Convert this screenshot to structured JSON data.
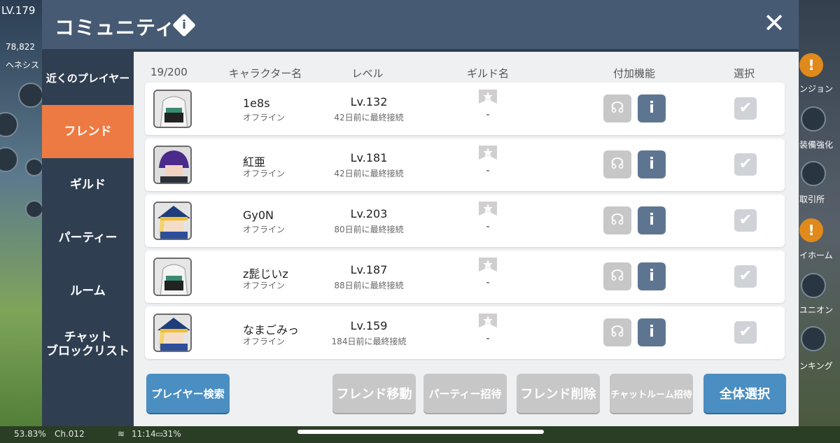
{
  "hud": {
    "level": "LV.179",
    "meso": "78,822",
    "map": "ヘネシス",
    "right_labels": [
      "ンジョン",
      "装備強化",
      "取引所",
      "イホーム",
      "ユニオン",
      "ンキング"
    ],
    "status": {
      "percent": "53.83%",
      "channel": "Ch.012",
      "time": "11:14",
      "battery": "31%"
    }
  },
  "dialog": {
    "title": "コミュニティ",
    "info_icon": "i",
    "close_icon": "✕"
  },
  "sidebar": {
    "items": [
      {
        "label": "近くのプレイヤー",
        "active": false
      },
      {
        "label": "フレンド",
        "active": true
      },
      {
        "label": "ギルド",
        "active": false
      },
      {
        "label": "パーティー",
        "active": false
      },
      {
        "label": "ルーム",
        "active": false
      },
      {
        "label": "チャット\nブロックリスト",
        "active": false
      }
    ]
  },
  "table": {
    "count": "19/200",
    "headers": {
      "name": "キャラクター名",
      "level": "レベル",
      "guild": "ギルド名",
      "features": "付加機能",
      "select": "選択"
    },
    "rows": [
      {
        "name": "1e8s",
        "status": "オフライン",
        "level": "Lv.132",
        "last_login": "42日前に最終接続",
        "guild": "-",
        "avatar": "white-hair-masked"
      },
      {
        "name": "紅亜",
        "status": "オフライン",
        "level": "Lv.181",
        "last_login": "42日前に最終接続",
        "guild": "-",
        "avatar": "purple-hair"
      },
      {
        "name": "Gy0N",
        "status": "オフライン",
        "level": "Lv.203",
        "last_login": "80日前に最終接続",
        "guild": "-",
        "avatar": "blue-hat-blonde"
      },
      {
        "name": "z髭じいz",
        "status": "オフライン",
        "level": "Lv.187",
        "last_login": "88日前に最終接続",
        "guild": "-",
        "avatar": "white-hair-masked"
      },
      {
        "name": "なまごみっ",
        "status": "オフライン",
        "level": "Lv.159",
        "last_login": "184日前に最終接続",
        "guild": "-",
        "avatar": "blue-hat-blonde"
      }
    ]
  },
  "buttons": {
    "player_search": "プレイヤー検索",
    "friend_move": "フレンド移動",
    "party_invite": "パーティー招待",
    "friend_delete": "フレンド削除",
    "chatroom_invite": "チャットルーム招待",
    "select_all": "全体選択"
  },
  "colors": {
    "header": "#475a73",
    "sidebar": "#2f3e51",
    "active_tab": "#ee7a43",
    "primary_button": "#4a8ec2",
    "disabled_button": "#c7c7c7",
    "info_button": "#5e7592"
  }
}
